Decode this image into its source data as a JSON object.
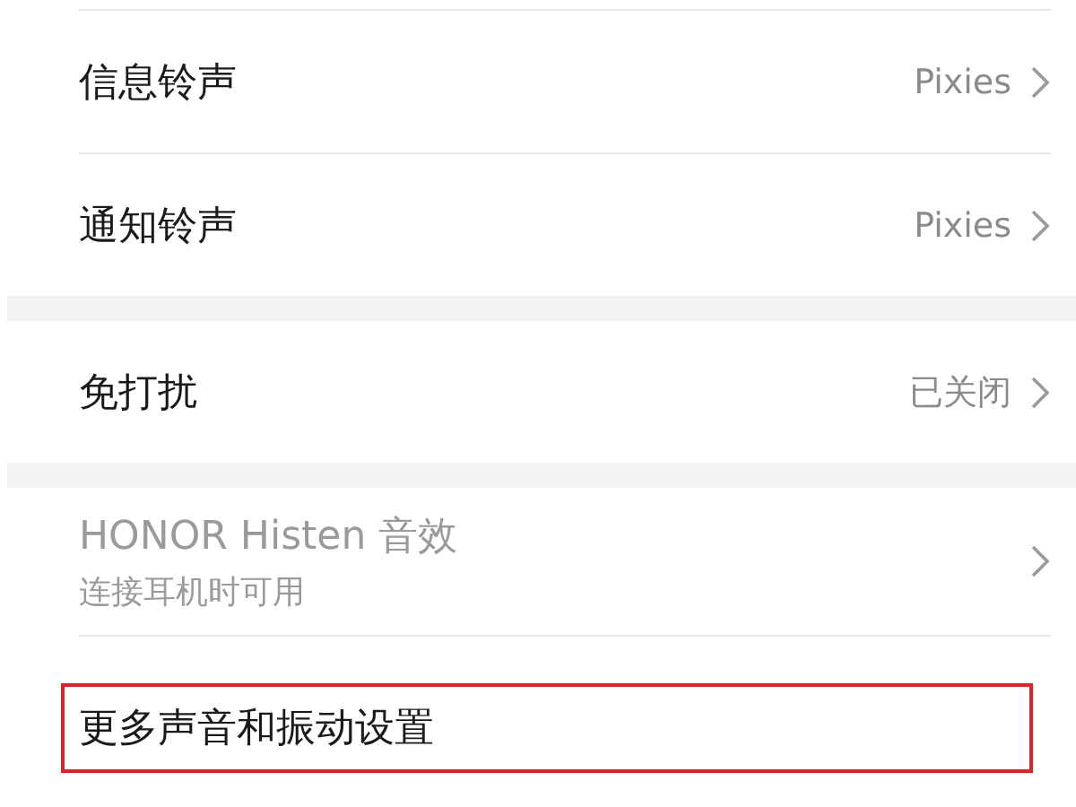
{
  "sections": [
    {
      "items": [
        {
          "title": "信息铃声",
          "value": "Pixies",
          "disabled": false,
          "highlighted": false
        },
        {
          "title": "通知铃声",
          "value": "Pixies",
          "disabled": false,
          "highlighted": false
        }
      ]
    },
    {
      "items": [
        {
          "title": "免打扰",
          "value": "已关闭",
          "disabled": false,
          "highlighted": false
        }
      ]
    },
    {
      "items": [
        {
          "title": "HONOR Histen 音效",
          "subtitle": "连接耳机时可用",
          "disabled": true,
          "highlighted": false
        },
        {
          "title": "更多声音和振动设置",
          "disabled": false,
          "highlighted": true
        }
      ]
    }
  ]
}
